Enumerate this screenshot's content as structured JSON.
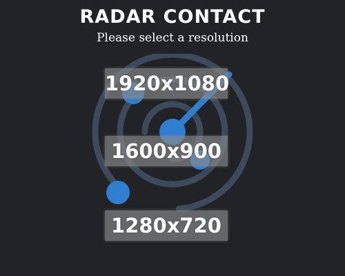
{
  "title": "RADAR CONTACT",
  "subtitle": "Please select a resolution",
  "resolutions": [
    {
      "label": "1920x1080"
    },
    {
      "label": "1600x900"
    },
    {
      "label": "1280x720"
    }
  ],
  "logo": {
    "icon": "radar-icon",
    "ring_color": "#3c4a5c",
    "accent_color": "#2f7fd0"
  },
  "colors": {
    "background": "#222326",
    "button": "#8a8a8a",
    "text": "#ffffff"
  }
}
